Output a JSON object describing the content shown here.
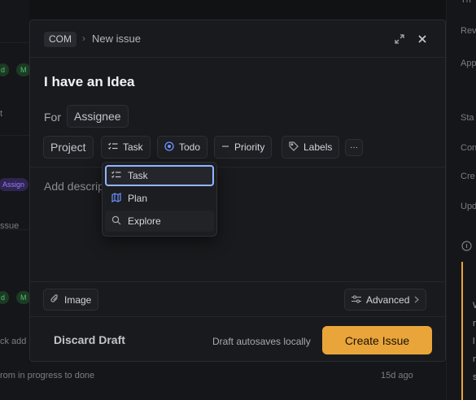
{
  "background": {
    "left_badges": [
      "d",
      "M",
      "d",
      "M"
    ],
    "left_fragments": [
      "t",
      "Assign",
      "ssue",
      "ck add",
      "rom in progress to done"
    ],
    "timestamp": "15d ago",
    "right_fragments": [
      "Th",
      "Rev",
      "App",
      "Sta",
      "Con",
      "Cre",
      "Upd",
      "W",
      "n",
      "l",
      "n",
      "s"
    ]
  },
  "modal": {
    "team": "COM",
    "breadcrumb_sep": "›",
    "breadcrumb_title": "New issue",
    "title": "I have an Idea",
    "for_label": "For",
    "assignee": "Assignee",
    "project": "Project",
    "type": "Task",
    "status": "Todo",
    "priority": "Priority",
    "labels": "Labels",
    "more": "···",
    "description_placeholder": "Add descrip",
    "image_button": "Image",
    "advanced_button": "Advanced",
    "discard": "Discard Draft",
    "autosave": "Draft autosaves locally",
    "create": "Create Issue"
  },
  "type_menu": {
    "items": [
      {
        "label": "Task",
        "icon": "task-list-icon"
      },
      {
        "label": "Plan",
        "icon": "map-icon"
      },
      {
        "label": "Explore",
        "icon": "search-icon"
      }
    ]
  },
  "colors": {
    "accent": "#e9a53a",
    "selection_ring": "#8fb6ff",
    "todo_status": "#6c93ff",
    "badge_green": "#4ec16b",
    "badge_purple": "#9a7bff"
  }
}
